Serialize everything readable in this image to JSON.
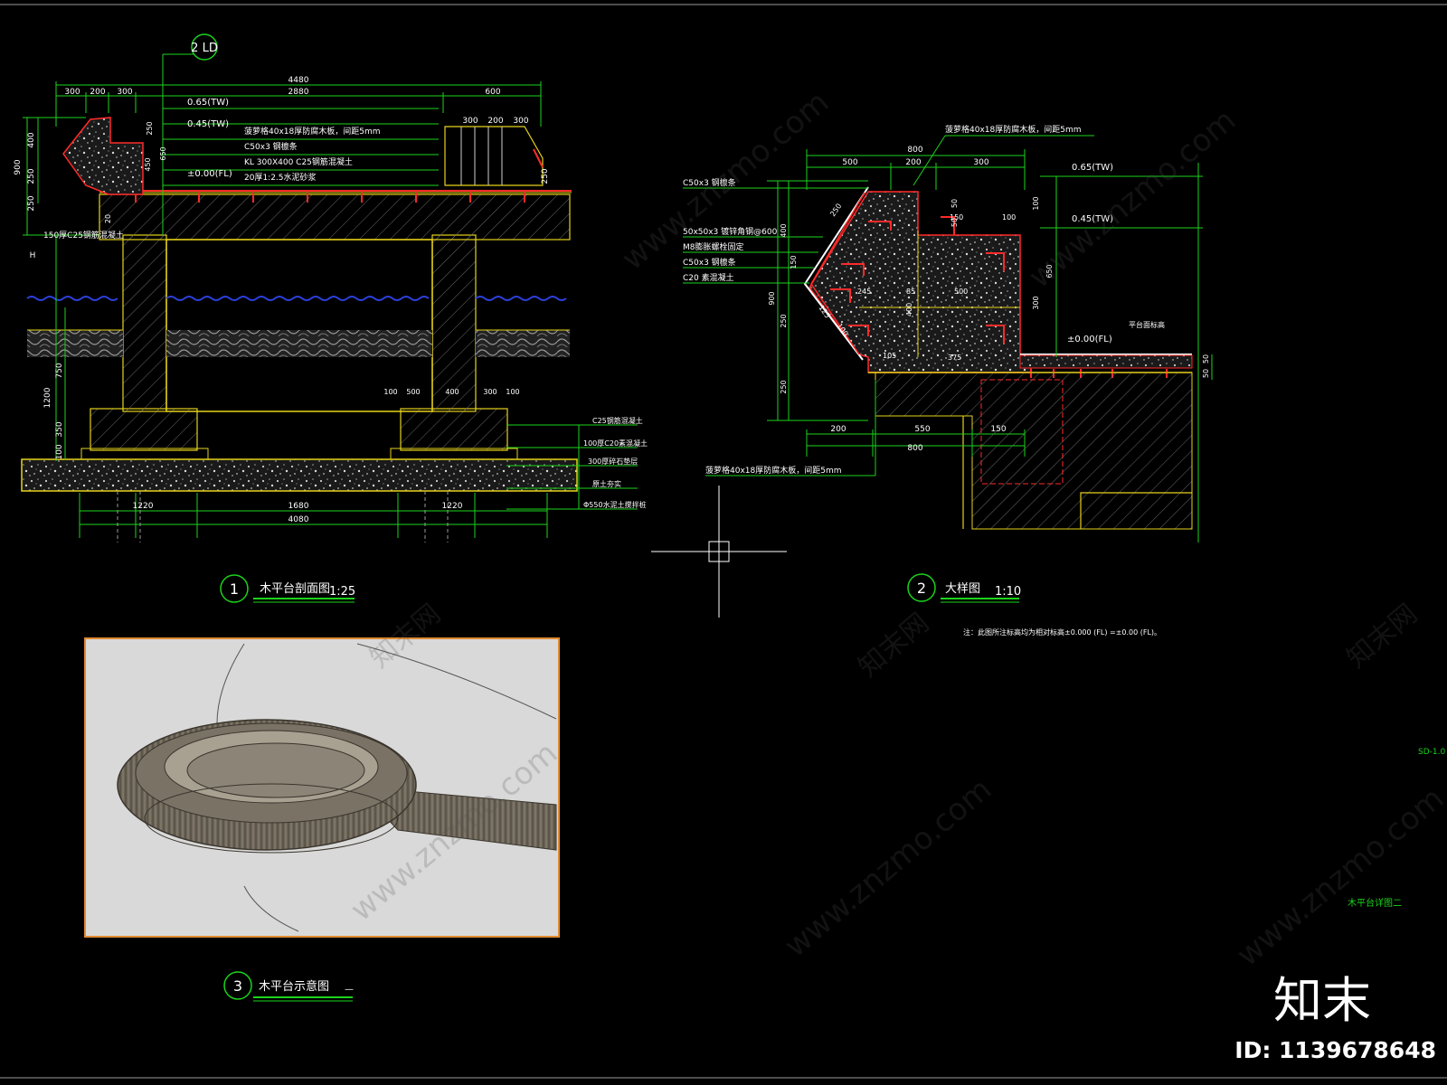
{
  "sheet": {
    "background": "#000000",
    "line_green": "#1bd31b",
    "line_yellow": "#e6d21a",
    "line_red": "#ff2a2a",
    "line_white": "#ffffff",
    "water_blue": "#2b3fd8"
  },
  "section1": {
    "number": "1",
    "title": "木平台剖面图",
    "scale": "1:25",
    "callout": "2 LD",
    "dims_top": [
      "300",
      "200",
      "300",
      "2880",
      "600",
      "4480"
    ],
    "dims_left": [
      "400",
      "250",
      "250",
      "900",
      "1200",
      "750",
      "350",
      "100",
      "H"
    ],
    "dims_bottom": [
      "1220",
      "1680",
      "1220",
      "4080"
    ],
    "dims_right_top": [
      "300",
      "200",
      "300",
      "250"
    ],
    "dims_small": [
      "20",
      "250",
      "650",
      "450",
      "100",
      "500",
      "400",
      "300",
      "100"
    ],
    "levels": [
      "0.65(TW)",
      "0.45(TW)",
      "±0.00(FL)"
    ],
    "notes": [
      "菠萝格40x18厚防腐木板，间距5mm",
      "C50x3 钢檩条",
      "KL 300X400 C25钢筋混凝土",
      "20厚1:2.5水泥砂浆"
    ],
    "side_note": "150厚C25钢筋混凝土",
    "layer_notes": [
      "C25钢筋混凝土",
      "100厚C20素混凝土",
      "300厚碎石垫层",
      "原土夯实",
      "Φ550水泥土搅拌桩"
    ]
  },
  "section2": {
    "number": "2",
    "title": "大样图",
    "scale": "1:10",
    "top_note": "菠萝格40x18厚防腐木板，间距5mm",
    "bottom_note": "菠萝格40x18厚防腐木板，间距5mm",
    "left_notes": [
      "C50x3 钢檩条",
      "50x50x3 镀锌角钢@600",
      "M8膨胀螺栓固定",
      "C50x3 钢檩条",
      "C20 素混凝土"
    ],
    "levels": [
      "0.65(TW)",
      "0.45(TW)",
      "±0.00(FL)"
    ],
    "level_note": "平台面标高",
    "dims_top": [
      "800",
      "500",
      "200",
      "300"
    ],
    "dims_right": [
      "100",
      "50",
      "50",
      "650",
      "300",
      "50",
      "50"
    ],
    "dims_left": [
      "400",
      "150",
      "900",
      "250",
      "250"
    ],
    "dims_inner": [
      "250",
      "245",
      "85",
      "500",
      "400",
      "105",
      "375",
      "150",
      "100",
      "125",
      "100"
    ],
    "dims_bottom": [
      "200",
      "550",
      "150",
      "800"
    ],
    "footnote": "注：此图所注标高均为相对标高±0.000 (FL) =±0.00 (FL)。"
  },
  "section3": {
    "number": "3",
    "title": "木平台示意图",
    "scale": "—"
  },
  "sheet_code": "SD-1.0",
  "sheet_title": "木平台详图二",
  "watermarks": [
    "www.znzmo.com",
    "知末网"
  ],
  "brand": {
    "logo": "知末",
    "id_label": "ID: 1139678648"
  }
}
